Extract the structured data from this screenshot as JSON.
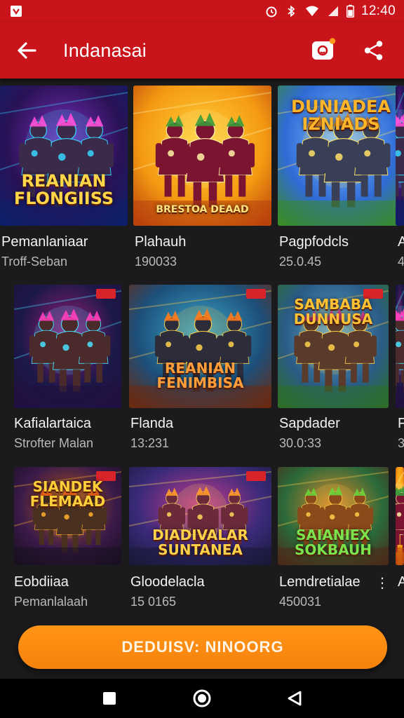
{
  "status_bar": {
    "time": "12:40"
  },
  "app_bar": {
    "title": "Indanasai"
  },
  "games": [
    {
      "title": "Pemanlaniaar",
      "subtitle": "Troff-Seban",
      "thumb_text": "REANIAN\nFLONGIISS",
      "thumb_theme": "violet",
      "text_color": "#ffd54a"
    },
    {
      "title": "Plahauh",
      "subtitle": "190033",
      "thumb_text": "Brestoa Deaad",
      "thumb_theme": "gold",
      "text_color": "#ffe27a"
    },
    {
      "title": "Pagpfodcls",
      "subtitle": "25.0.45",
      "thumb_text": "DUNIADEA\nIZNIADS",
      "thumb_theme": "field",
      "text_color": "#ffb52a"
    },
    {
      "title": "Kafialartaica",
      "subtitle": "Strofter Malan",
      "thumb_text": "",
      "thumb_theme": "magenta",
      "text_color": "#ffd54a"
    },
    {
      "title": "Flanda",
      "subtitle": "13:231",
      "thumb_text": "REANIAN\nFENIMBISA",
      "thumb_theme": "teal",
      "text_color": "#ff9e3a"
    },
    {
      "title": "Sapdader",
      "subtitle": "30.0:33",
      "thumb_text": "SAMBABA\nDUNNUSA",
      "thumb_theme": "jungle",
      "text_color": "#ffc234"
    },
    {
      "title": "Eobdiiaa",
      "subtitle": "Pemanlalaah",
      "thumb_text": "SIANDEK\nFLEMAAD",
      "thumb_theme": "ember",
      "text_color": "#ffcf3a"
    },
    {
      "title": "Gloodelacla",
      "subtitle": "15 0165",
      "thumb_text": "DIADIVALAR\nSUNTANEA",
      "thumb_theme": "rose",
      "text_color": "#ffd04a"
    },
    {
      "title": "Lemdretialae",
      "subtitle": "450031",
      "thumb_text": "SAIANIEX\nSOKBAUH",
      "thumb_theme": "lion",
      "text_color": "#7be34d"
    }
  ],
  "edge_titles": [
    "A",
    "F",
    "A"
  ],
  "edge_subs": [
    "4",
    "3",
    ""
  ],
  "more_glyph": "⋮",
  "cta_label": "DEDUISV: NINOORG",
  "colors": {
    "primary": "#c8141a",
    "accent": "#f5820c",
    "background": "#1b1b1d"
  }
}
